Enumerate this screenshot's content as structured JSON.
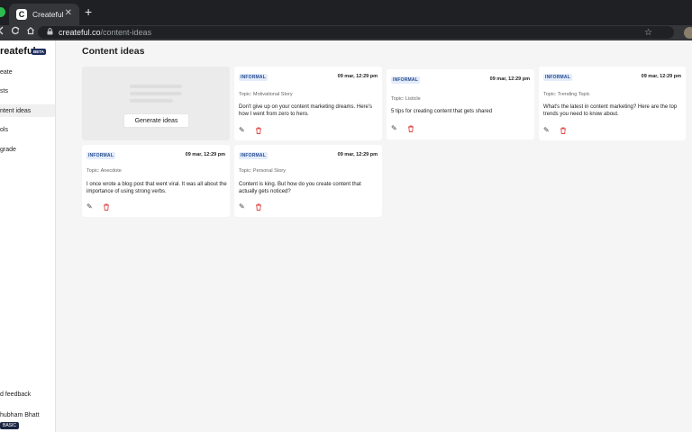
{
  "browser": {
    "tab_title": "Createful",
    "tab_icon": "C",
    "close_glyph": "✕",
    "new_tab_glyph": "+",
    "url_host": "createful.co",
    "url_path": "/content-ideas",
    "icons": {
      "back": "back-arrow-icon",
      "reload": "reload-icon",
      "home": "home-icon",
      "lock": "lock-icon",
      "star": "star-icon"
    }
  },
  "sidebar": {
    "brand": "reateful",
    "brand_badge": "BETA",
    "items": [
      {
        "label": "eate",
        "active": false
      },
      {
        "label": "sts",
        "active": false
      },
      {
        "label": "ntent ideas",
        "active": true
      },
      {
        "label": "ols",
        "active": false
      },
      {
        "label": "grade",
        "active": false
      }
    ],
    "feedback": "d feedback",
    "user_name": "hubham Bhatt",
    "plan": "BASIC"
  },
  "main": {
    "title": "Content ideas",
    "generate_button": "Generate ideas",
    "cards": [
      {
        "tone": "INFORMAL",
        "date": "09 mar, 12:29 pm",
        "topic": "Topic: Motivational Story",
        "text": "Don't give up on your content marketing dreams. Here's how I went from zero to hero."
      },
      {
        "tone": "INFORMAL",
        "date": "09 mar, 12:29 pm",
        "topic": "Topic: Listicle",
        "text": "5 tips for creating content that gets shared"
      },
      {
        "tone": "INFORMAL",
        "date": "09 mar, 12:29 pm",
        "topic": "Topic: Trending Topic",
        "text": "What's the latest in content marketing? Here are the top trends you need to know about."
      },
      {
        "tone": "INFORMAL",
        "date": "09 mar, 12:29 pm",
        "topic": "Topic: Anecdote",
        "text": "I once wrote a blog post that went viral. It was all about the importance of using strong verbs."
      },
      {
        "tone": "INFORMAL",
        "date": "09 mar, 12:29 pm",
        "topic": "Topic: Personal Story",
        "text": "Content is king. But how do you create content that actually gets noticed?"
      }
    ],
    "card_icons": {
      "edit": "pencil-icon",
      "delete": "trash-icon"
    },
    "colors": {
      "tag_text": "#274b8f",
      "tag_bg": "#e3ecfb",
      "delete": "#e04848",
      "brand_badge": "#1f2f5e"
    }
  }
}
